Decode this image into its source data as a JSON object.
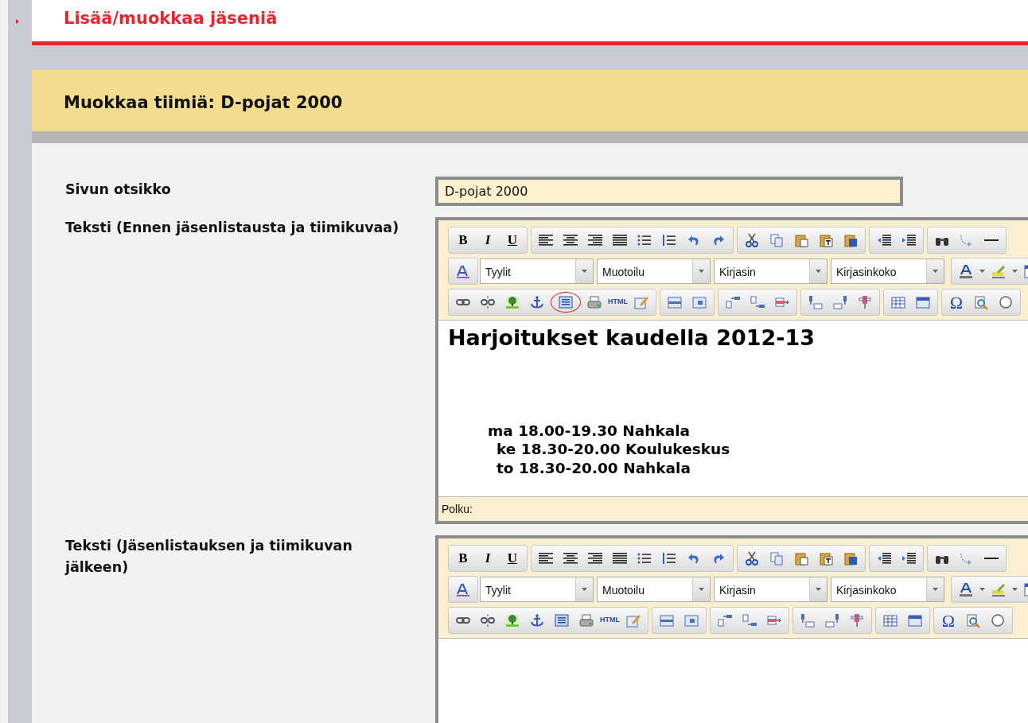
{
  "header": {
    "title": "Lisää/muokkaa jäseniä"
  },
  "panel": {
    "title": "Muokkaa tiimiä: D-pojat 2000"
  },
  "fields": [
    {
      "kind": "text",
      "label": "Sivun otsikko",
      "value": "D-pojat 2000"
    },
    {
      "kind": "editor",
      "label": "Teksti (Ennen jäsenlistausta ja tiimikuvaa)",
      "annotated": true,
      "bold": "B",
      "italic": "I",
      "underline": "U",
      "selects": [
        "Tyylit",
        "Muotoilu",
        "Kirjasin",
        "Kirjasinkoko"
      ],
      "html": "HTML",
      "omega": "Ω",
      "path": "Polku:",
      "content": [
        {
          "kind": "heading",
          "text": "Harjoitukset kaudella 2012-13"
        },
        {
          "kind": "line",
          "text": "ma 18.00-19.30 Nahkala"
        },
        {
          "kind": "indented",
          "text": "ke 18.30-20.00 Koulukeskus"
        },
        {
          "kind": "indented",
          "text": "to 18.30-20.00 Nahkala"
        }
      ]
    },
    {
      "kind": "editor",
      "label": "Teksti (Jäsenlistauksen ja tiimikuvan jälkeen)",
      "annotated": false,
      "bold": "B",
      "italic": "I",
      "underline": "U",
      "selects": [
        "Tyylit",
        "Muotoilu",
        "Kirjasin",
        "Kirjasinkoko"
      ],
      "html": "HTML",
      "omega": "Ω"
    }
  ]
}
